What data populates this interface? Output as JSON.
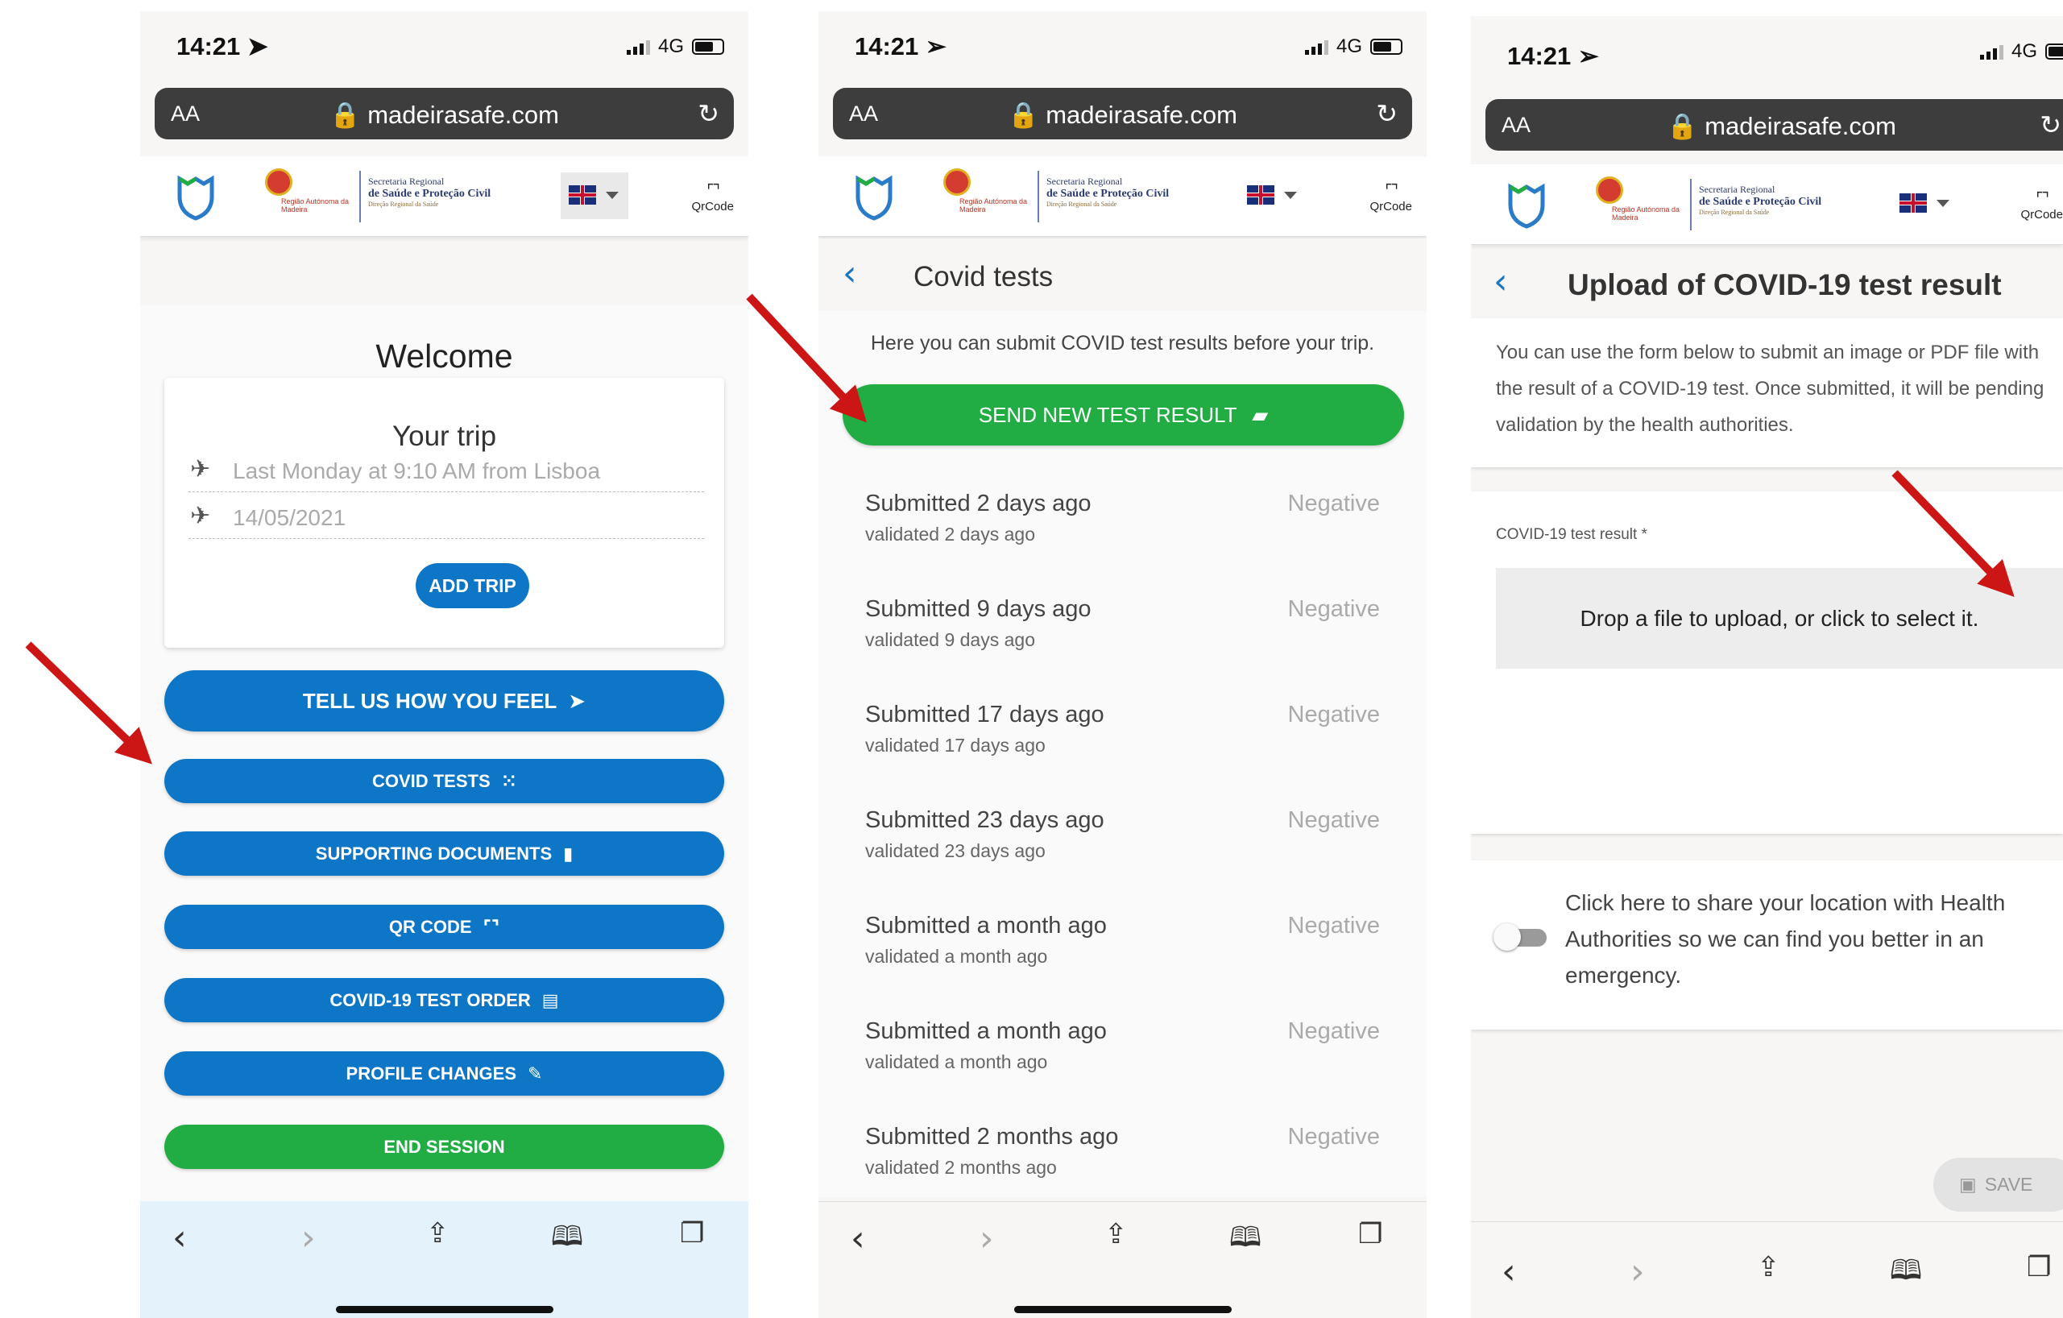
{
  "status": {
    "time": "14:21",
    "network": "4G"
  },
  "browser": {
    "text_size": "AA",
    "url": "madeirasafe.com"
  },
  "header": {
    "region_text": "Região Autónoma da Madeira",
    "secretaria_line1": "Secretaria Regional",
    "secretaria_line2": "de Saúde e Proteção Civil",
    "secretaria_line3": "Direção Regional da Saúde",
    "qr_label": "QrCode"
  },
  "home": {
    "welcome": "Welcome",
    "trip_title": "Your trip",
    "departure": "Last Monday at 9:10 AM from Lisboa",
    "arrival": "14/05/2021",
    "add_trip": "ADD TRIP",
    "tell_us": "TELL US HOW YOU FEEL",
    "covid_tests": "COVID TESTS",
    "supporting_docs": "SUPPORTING DOCUMENTS",
    "qr_code": "QR CODE",
    "test_order": "COVID-19 TEST ORDER",
    "profile_changes": "PROFILE CHANGES",
    "end_session": "END SESSION"
  },
  "covid": {
    "title": "Covid tests",
    "intro": "Here you can submit COVID test results before your trip.",
    "send_button": "SEND NEW TEST RESULT",
    "results": [
      {
        "submitted": "Submitted 2 days ago",
        "validated": "validated 2 days ago",
        "result": "Negative"
      },
      {
        "submitted": "Submitted 9 days ago",
        "validated": "validated 9 days ago",
        "result": "Negative"
      },
      {
        "submitted": "Submitted 17 days ago",
        "validated": "validated 17 days ago",
        "result": "Negative"
      },
      {
        "submitted": "Submitted 23 days ago",
        "validated": "validated 23 days ago",
        "result": "Negative"
      },
      {
        "submitted": "Submitted a month ago",
        "validated": "validated a month ago",
        "result": "Negative"
      },
      {
        "submitted": "Submitted a month ago",
        "validated": "validated a month ago",
        "result": "Negative"
      },
      {
        "submitted": "Submitted 2 months ago",
        "validated": "validated 2 months ago",
        "result": "Negative"
      }
    ]
  },
  "upload": {
    "title": "Upload of COVID-19 test result",
    "intro": "You can use the form below to submit an image or PDF file with the result of a COVID-19 test. Once submitted, it will be pending validation by the health authorities.",
    "field_label": "COVID-19 test result *",
    "dropzone": "Drop a file to upload, or click to select it.",
    "location_text": "Click here to share your location with Health Authorities so we can find you better in an emergency.",
    "save": "SAVE"
  },
  "colors": {
    "primary": "#0e76c6",
    "green": "#22ac44",
    "arrow": "#cc1616"
  },
  "icons": [
    "location-arrow-icon",
    "lock-icon",
    "reload-icon",
    "madeira-shield-icon",
    "uk-flag-icon",
    "qr-code-icon",
    "takeoff-icon",
    "landing-icon",
    "send-icon",
    "grid-icon",
    "document-icon",
    "id-card-icon",
    "pencil-icon",
    "chevron-left-icon",
    "floppy-icon",
    "share-icon",
    "book-icon",
    "tabs-icon"
  ]
}
